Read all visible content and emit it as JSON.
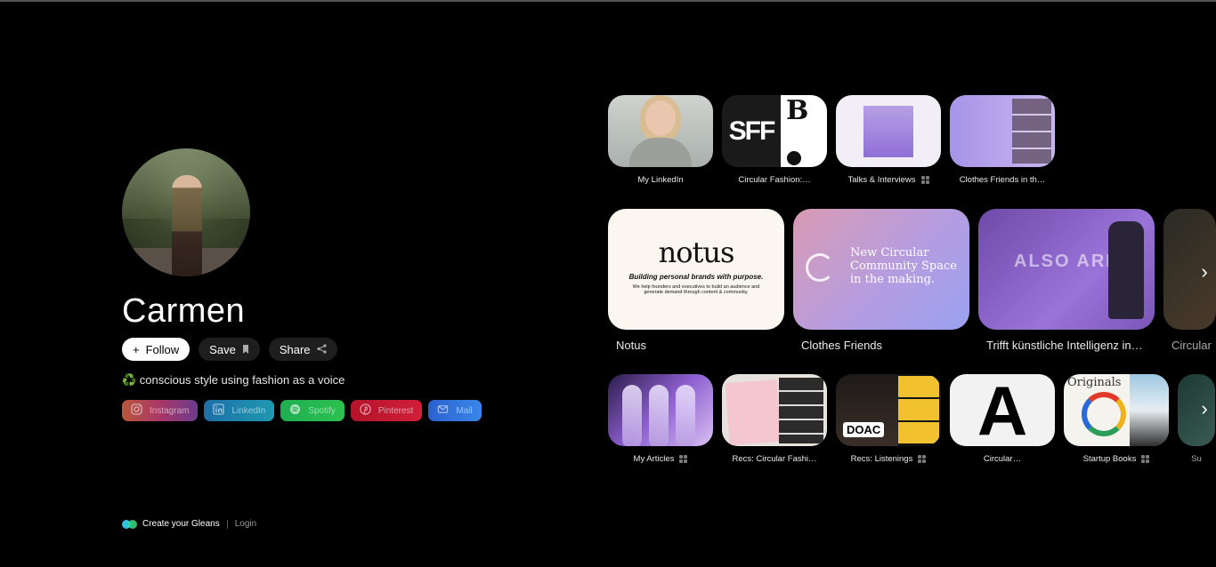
{
  "profile": {
    "name": "Carmen",
    "follow_label": "Follow",
    "save_label": "Save",
    "share_label": "Share",
    "bio": "♻️ conscious style using fashion as a voice",
    "socials": [
      {
        "label": "Instagram",
        "icon": "instagram-icon",
        "color": "#a83868"
      },
      {
        "label": "LinkedIn",
        "icon": "linkedin-icon",
        "color": "#1d6fa8"
      },
      {
        "label": "Spotify",
        "icon": "spotify-icon",
        "color": "#1fae52"
      },
      {
        "label": "Pinterest",
        "icon": "pinterest-icon",
        "color": "#c41a32"
      },
      {
        "label": "Mail",
        "icon": "mail-icon",
        "color": "#2a62d0"
      }
    ]
  },
  "footer": {
    "create_label": "Create your Gleans",
    "login_label": "Login"
  },
  "row1": [
    {
      "label": "My LinkedIn"
    },
    {
      "label": "Circular Fashion:…",
      "thumb_text": "SFF"
    },
    {
      "label": "Talks & Interviews"
    },
    {
      "label": "Clothes Friends in th…"
    }
  ],
  "row2": [
    {
      "label": "Notus",
      "thumb_title": "notus",
      "thumb_sub": "Building personal brands with purpose.",
      "thumb_small": "We help founders and executives to build an audience and generate demand through content & community."
    },
    {
      "label": "Clothes Friends",
      "thumb_text": "New Circular Community Space in the making."
    },
    {
      "label": "Trifft künstliche Intelligenz in…",
      "thumb_text": "ALSO ARIT"
    },
    {
      "label": "Circular"
    }
  ],
  "row3": [
    {
      "label": "My Articles"
    },
    {
      "label": "Recs: Circular Fashi…"
    },
    {
      "label": "Recs: Listenings",
      "thumb_text": "DOAC"
    },
    {
      "label": "Circular…",
      "thumb_text": "A"
    },
    {
      "label": "Startup Books",
      "thumb_text": "Originals"
    },
    {
      "label": "Su"
    }
  ]
}
